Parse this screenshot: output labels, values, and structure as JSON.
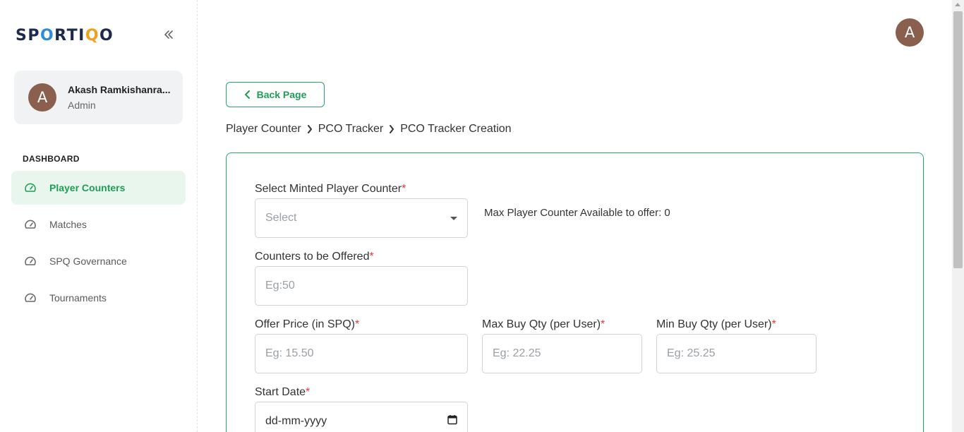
{
  "brand": {
    "logo_text": "SPORTIQO"
  },
  "sidebar": {
    "user": {
      "initial": "A",
      "name": "Akash Ramkishanra...",
      "role": "Admin"
    },
    "section_label": "DASHBOARD",
    "items": [
      {
        "label": "Player Counters",
        "icon": "gauge-icon",
        "active": true
      },
      {
        "label": "Matches",
        "icon": "gauge-icon",
        "active": false
      },
      {
        "label": "SPQ Governance",
        "icon": "gauge-icon",
        "active": false
      },
      {
        "label": "Tournaments",
        "icon": "gauge-icon",
        "active": false
      }
    ]
  },
  "header": {
    "avatar_initial": "A"
  },
  "main": {
    "back_button": "Back Page",
    "breadcrumb": [
      "Player Counter",
      "PCO Tracker",
      "PCO Tracker Creation"
    ],
    "form": {
      "minted_counter": {
        "label": "Select Minted Player Counter",
        "required": "*",
        "placeholder": "Select"
      },
      "max_available": "Max Player Counter Available to offer: 0",
      "counters_offered": {
        "label": "Counters to be Offered",
        "required": "*",
        "placeholder": "Eg:50"
      },
      "offer_price": {
        "label": "Offer Price (in SPQ)",
        "required": "*",
        "placeholder": "Eg: 15.50"
      },
      "max_buy": {
        "label": "Max Buy Qty (per User)",
        "required": "*",
        "placeholder": "Eg: 22.25"
      },
      "min_buy": {
        "label": "Min Buy Qty (per User)",
        "required": "*",
        "placeholder": "Eg: 25.25"
      },
      "start_date": {
        "label": "Start Date",
        "required": "*",
        "placeholder": "dd-mm-yyyy"
      }
    }
  },
  "colors": {
    "accent": "#1f9d55",
    "avatar": "#8b5f4e",
    "required": "#e53935"
  }
}
